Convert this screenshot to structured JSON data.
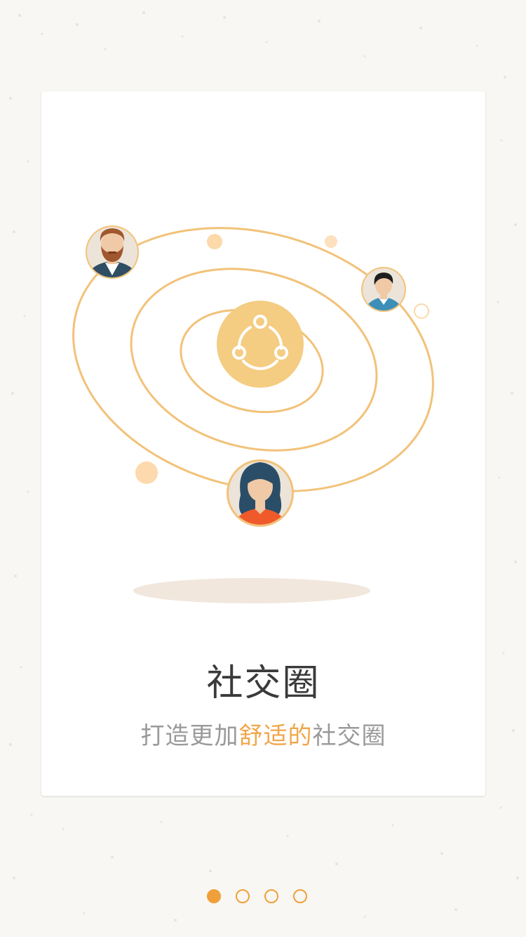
{
  "onboarding": {
    "title": "社交圈",
    "subtitle_pre": "打造更加",
    "subtitle_highlight": "舒适的",
    "subtitle_post": "社交圈"
  },
  "pager": {
    "page_count": 4,
    "current_page": 1
  },
  "colors": {
    "accent": "#f0a03a",
    "orbit": "#f2c27a",
    "center": "#f4cc82",
    "title": "#3a3a3a",
    "subtitle": "#9a9a9a",
    "highlight": "#f0a64a"
  },
  "icons": {
    "center": "social-circle-icon",
    "avatars": [
      "man-beard-avatar",
      "man-dark-hair-avatar",
      "woman-avatar"
    ]
  }
}
